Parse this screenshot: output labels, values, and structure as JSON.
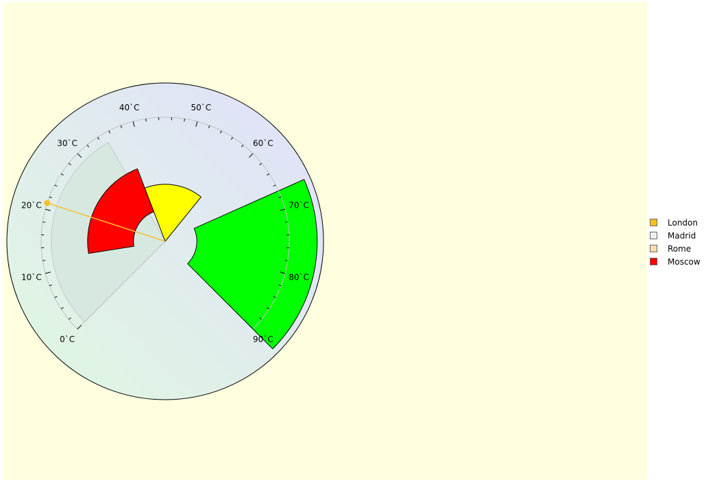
{
  "chart_data": {
    "type": "gauge",
    "scale": {
      "min": 0,
      "max": 90,
      "unit": "`C",
      "major_ticks": [
        0,
        10,
        20,
        30,
        40,
        50,
        60,
        70,
        80,
        90
      ],
      "minor_step": 2,
      "start_angle_deg": 225,
      "end_angle_deg": -45
    },
    "tick_labels": [
      "0`C",
      "10`C",
      "20`C",
      "30`C",
      "40`C",
      "50`C",
      "60`C",
      "70`C",
      "80`C",
      "90`C"
    ],
    "bands": [
      {
        "name": "Madrid",
        "from": 0,
        "to": 35,
        "inner_ratio": 0.0,
        "outer_ratio": 0.72,
        "color": "#d6e8e0",
        "stroke": "#c8c8c8"
      },
      {
        "name": "Moscow",
        "from": 12,
        "to": 38,
        "inner_ratio": 0.2,
        "outer_ratio": 0.49,
        "color": "#ff0000",
        "stroke": "#000000"
      },
      {
        "name": "London",
        "from": 38,
        "to": 58,
        "inner_ratio": 0.0,
        "outer_ratio": 0.36,
        "color": "#ffff00",
        "stroke": "#000000"
      },
      {
        "name": "Rome",
        "from": 67,
        "to": 90,
        "inner_ratio": 0.2,
        "outer_ratio": 0.96,
        "color": "#00ff00",
        "stroke": "#000000"
      }
    ],
    "needle": {
      "value": 21,
      "color": "#f5c030"
    },
    "legend": [
      {
        "label": "London",
        "color": "#ffc020"
      },
      {
        "label": "Madrid",
        "color": "#f0f0f0"
      },
      {
        "label": "Rome",
        "color": "#ffdead"
      },
      {
        "label": "Moscow",
        "color": "#ff0000"
      }
    ],
    "legend_position": "right"
  }
}
